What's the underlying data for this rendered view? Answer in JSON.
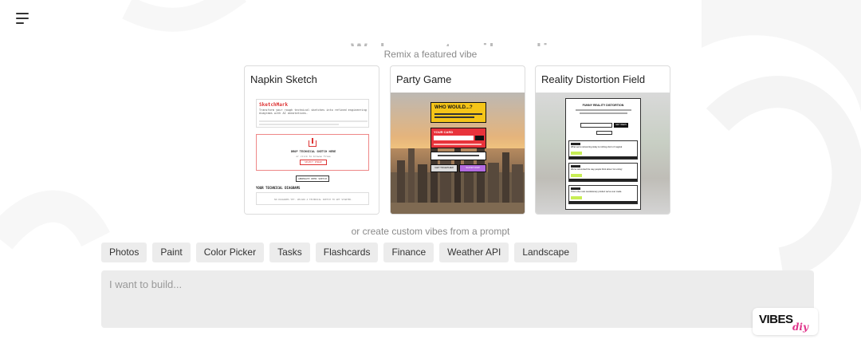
{
  "header": {
    "menu_icon": "hamburger-menu-icon",
    "ghost_heading": "Welcome to vibes.diy"
  },
  "featured": {
    "label": "Remix a featured vibe",
    "cards": [
      {
        "title": "Napkin Sketch",
        "thumb": {
          "app_title": "SketchMark",
          "tagline": "Transform your rough technical sketches into refined engineering diagrams with AI annotations.",
          "upload_title": "DROP TECHNICAL SKETCH HERE",
          "upload_sub": "or click to browse files",
          "upload_btn": "SELECT IMAGE",
          "demo_btn": "GENERATE DEMO SKETCH",
          "section": "YOUR TECHNICAL DIAGRAMS",
          "empty": "NO DIAGRAMS YET. UPLOAD A TECHNICAL SKETCH TO GET STARTED."
        }
      },
      {
        "title": "Party Game",
        "thumb": {
          "banner": "WHO WOULD...?",
          "your_card": "YOUR CARD",
          "btn1": "GET TOGETHER",
          "btn2": "SHOW NOW"
        }
      },
      {
        "title": "Reality Distortion Field",
        "thumb": {
          "doc_title": "FUNNY REALITY DISTORTION",
          "btn": "GET IDEAS",
          "q1": "What we're reinventing today is nothing short of magical",
          "q2": "We've reinvented the way people think about 'not voting.'",
          "q3": "This is the most revolutionary product we've ever made."
        }
      }
    ]
  },
  "custom": {
    "label": "or create custom vibes from a prompt",
    "chips": [
      "Photos",
      "Paint",
      "Color Picker",
      "Tasks",
      "Flashcards",
      "Finance",
      "Weather API",
      "Landscape"
    ]
  },
  "prompt": {
    "placeholder": "I want to build..."
  },
  "logo": {
    "main": "VIBES",
    "sub": "diy"
  }
}
